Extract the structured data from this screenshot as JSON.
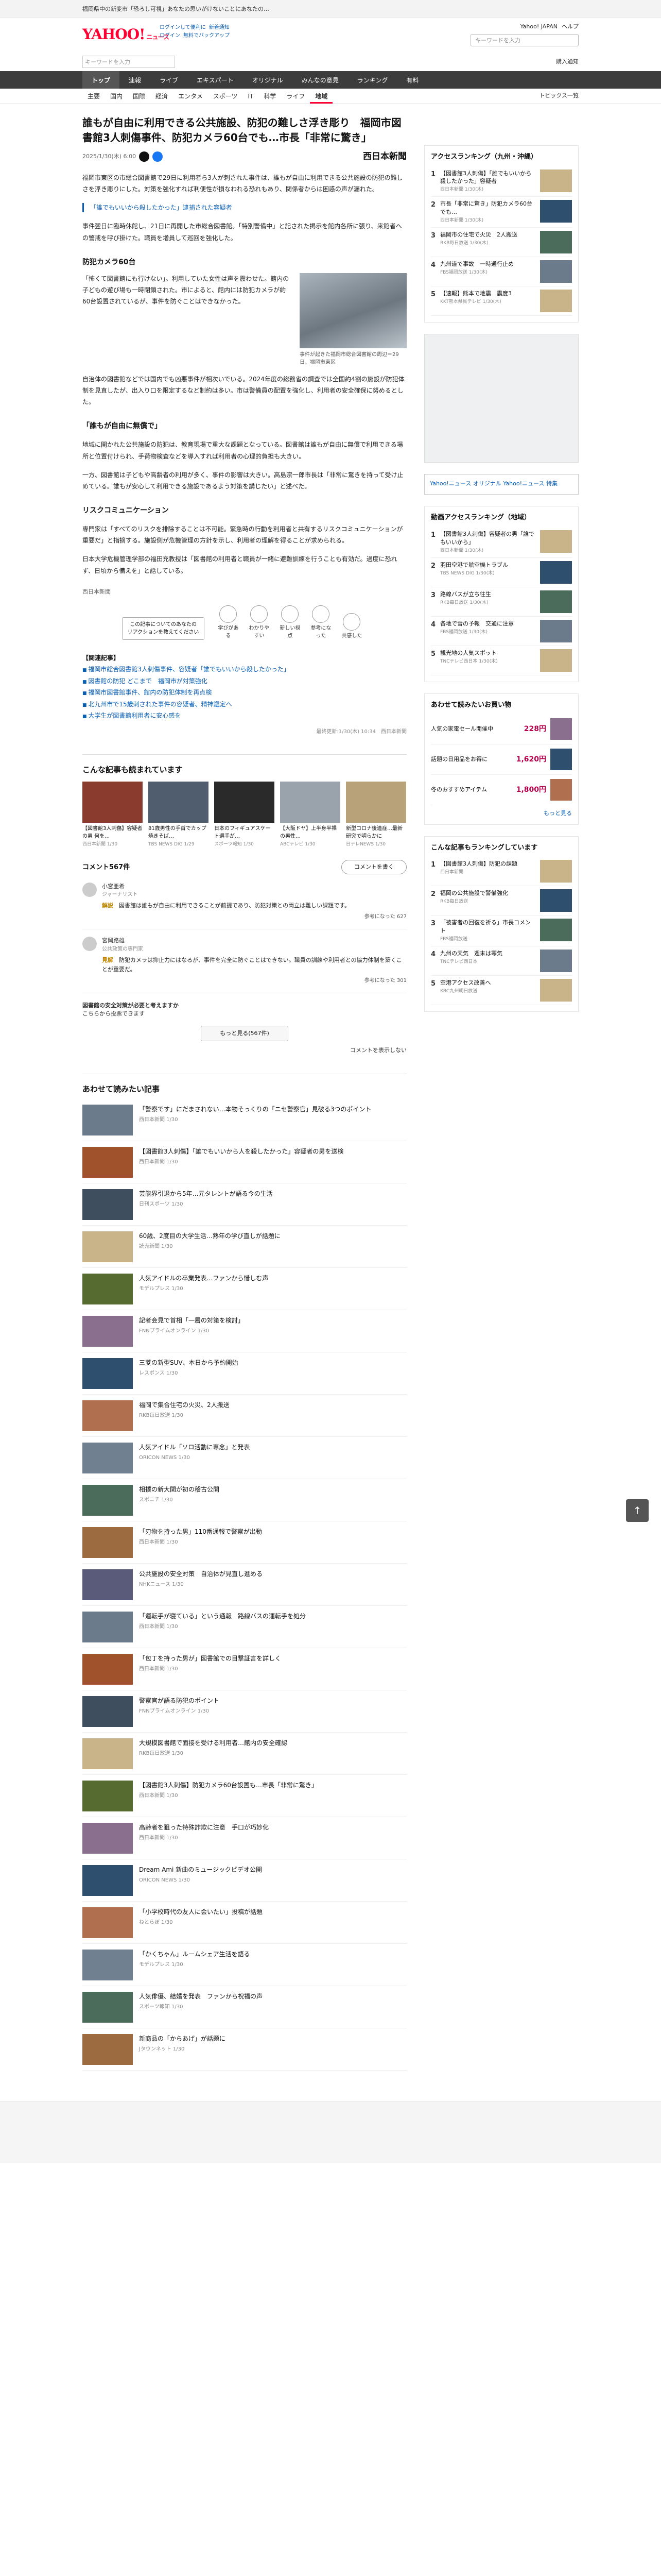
{
  "promo": {
    "text": "福岡県中の新変市「恐ろし可視」あなたの思いがけないことにあなたの…"
  },
  "masthead": {
    "logo": "YAHOO!",
    "logo_sub": "JAPAN",
    "service": "ニュース",
    "links": [
      "ログインして便利に",
      "新着通知",
      "ログイン",
      "無料でバックアップ"
    ],
    "right_links": [
      "Yahoo! JAPAN",
      "ヘルプ"
    ],
    "search_placeholder": "キーワードを入力"
  },
  "searchrow": {
    "placeholder": "キーワードを入力",
    "right": "購入通知"
  },
  "gnav": [
    "トップ",
    "速報",
    "ライブ",
    "エキスパート",
    "オリジナル",
    "みんなの意見",
    "ランキング",
    "有料"
  ],
  "gnav_active": 0,
  "subnav": [
    "主要",
    "国内",
    "国際",
    "経済",
    "エンタメ",
    "スポーツ",
    "IT",
    "科学",
    "ライフ",
    "地域"
  ],
  "subnav_active": 9,
  "subnav_right": "トピックス一覧",
  "article": {
    "title": "誰もが自由に利用できる公共施設、防犯の難しさ浮き彫り　福岡市図書館3人刺傷事件、防犯カメラ60台でも…市長「非常に驚き」",
    "date": "2025/1/30(木) 6:00",
    "publisher": "西日本新聞",
    "lead": "福岡市東区の市総合図書館で29日に利用者ら3人が刺された事件は、誰もが自由に利用できる公共施設の防犯の難しさを浮き彫りにした。対策を強化すれば利便性が損なわれる恐れもあり、関係者からは困惑の声が漏れた。",
    "related_link": "「誰でもいいから殺したかった」逮捕された容疑者",
    "p1": "事件翌日に臨時休館し、21日に再開した市総合図書館。「特別警備中」と記された掲示を館内各所に張り、来館者への警戒を呼び掛けた。職員を増員して巡回を強化した。",
    "h2a": "防犯カメラ60台",
    "fig_text": "「怖くて図書館にも行けない」。利用していた女性は声を震わせた。館内の子どもの遊び場も一時閉鎖された。市によると、館内には防犯カメラが約60台設置されているが、事件を防ぐことはできなかった。",
    "fig_caption": "事件が起きた福岡市総合図書館の周辺＝29日、福岡市東区",
    "p2": "自治体の図書館などでは国内でも凶悪事件が相次いでいる。2024年度の総務省の調査では全国約4割の施設が防犯体制を見直したが、出入り口を限定するなど制約は多い。市は警備員の配置を強化し、利用者の安全確保に努めるとした。",
    "h2b": "「誰もが自由に無償で」",
    "p3": "地域に開かれた公共施設の防犯は、教育現場で重大な課題となっている。図書館は誰もが自由に無償で利用できる場所と位置付けられ、手荷物検査などを導入すれば利用者の心理的負担も大きい。",
    "p4": "一方、図書館は子どもや高齢者の利用が多く、事件の影響は大きい。高島宗一郎市長は「非常に驚きを持って受け止めている。誰もが安心して利用できる施設であるよう対策を講じたい」と述べた。",
    "h2c": "リスクコミュニケーション",
    "p5": "専門家は「すべてのリスクを排除することは不可能。緊急時の行動を利用者と共有するリスクコミュニケーションが重要だ」と指摘する。施設側が危機管理の方針を示し、利用者の理解を得ることが求められる。",
    "p6": "日本大学危機管理学部の福田充教授は「図書館の利用者と職員が一緒に避難訓練を行うことも有効だ。過度に恐れず、日頃から備えを」と話している。",
    "source": "西日本新聞",
    "bubble": "この記事についてのあなたの\nリアクションを教えてください",
    "reactions": [
      "学びがある",
      "わかりやすい",
      "新しい視点",
      "参考になった",
      "共感した"
    ],
    "related_title": "【関連記事】",
    "related": [
      "福岡市総合図書館3人刺傷事件、容疑者「誰でもいいから殺したかった」",
      "図書館の防犯 どこまで　福岡市が対策強化",
      "福岡市図書館事件、館内の防犯体制を再点検",
      "北九州市で15歳刺された事件の容疑者、精神鑑定へ",
      "大学生が図書館利用者に安心感を"
    ],
    "copyright": "最終更新:1/30(木) 10:34　西日本新聞"
  },
  "sections": {
    "also_read": "こんな記事も読まれています",
    "thumbs": [
      {
        "title": "【図書館3人刺傷】容疑者の男 何を…",
        "meta": "西日本新聞 1/30"
      },
      {
        "title": "81歳男性の手首でカップ焼きそば…",
        "meta": "TBS NEWS DIG 1/29"
      },
      {
        "title": "日本のフィギュアスケート選手が…",
        "meta": "スポーツ報知 1/30"
      },
      {
        "title": "【大阪ドヤ】上半身半裸の男性…",
        "meta": "ABCテレビ 1/30"
      },
      {
        "title": "新型コロナ後遺症…最新研究で明らかに",
        "meta": "日テレNEWS 1/30"
      }
    ],
    "comments_count": "コメント567件",
    "post_btn": "コメントを書く",
    "comments": [
      {
        "name": "小宮亜希",
        "role": "ジャーナリスト",
        "tag": "解説",
        "text": "図書館は誰もが自由に利用できることが前提であり、防犯対策との両立は難しい課題です。",
        "more": "参考になった 627"
      },
      {
        "name": "宮岡路雄",
        "role": "公共政策の専門家",
        "tag": "見解",
        "text": "防犯カメラは抑止力にはなるが、事件を完全に防ぐことはできない。職員の訓練や利用者との協力体制を築くことが重要だ。",
        "more": "参考になった 301"
      }
    ],
    "survey_q": "図書館の安全対策が必要と考えますか",
    "survey_sub": "こちらから投票できます",
    "more_comments": "もっと見る(567件)",
    "hide_comments": "コメントを表示しない",
    "recommend": "あわせて読みたい記事",
    "recs": [
      {
        "title": "「警察です」にだまされない…本物そっくりの「ニセ警察官」見破る3つのポイント",
        "meta": "西日本新聞 1/30"
      },
      {
        "title": "【図書館3人刺傷】「誰でもいいから人を殺したかった」容疑者の男を送検",
        "meta": "西日本新聞 1/30"
      },
      {
        "title": "芸能界引退から5年…元タレントが語る今の生活",
        "meta": "日刊スポーツ 1/30"
      },
      {
        "title": "60歳、2度目の大学生活…熟年の学び直しが話題に",
        "meta": "読売新聞 1/30"
      },
      {
        "title": "人気アイドルの卒業発表…ファンから惜しむ声",
        "meta": "モデルプレス 1/30"
      },
      {
        "title": "記者会見で首相「一層の対策を検討」",
        "meta": "FNNプライムオンライン 1/30"
      },
      {
        "title": "三菱の新型SUV、本日から予約開始",
        "meta": "レスポンス 1/30"
      },
      {
        "title": "福岡で集合住宅の火災、2人搬送",
        "meta": "RKB毎日放送 1/30"
      },
      {
        "title": "人気アイドル「ソロ活動に専念」と発表",
        "meta": "ORICON NEWS 1/30"
      },
      {
        "title": "相撲の新大関が初の稽古公開",
        "meta": "スポニチ 1/30"
      },
      {
        "title": "「刃物を持った男」110番通報で警察が出動",
        "meta": "西日本新聞 1/30"
      },
      {
        "title": "公共施設の安全対策　自治体が見直し進める",
        "meta": "NHKニュース 1/30"
      },
      {
        "title": "「運転手が寝ている」という通報　路線バスの運転手を処分",
        "meta": "西日本新聞 1/30"
      },
      {
        "title": "「包丁を持った男が」図書館での目撃証言を詳しく",
        "meta": "西日本新聞 1/30"
      },
      {
        "title": "警察官が語る防犯のポイント",
        "meta": "FNNプライムオンライン 1/30"
      },
      {
        "title": "大規模図書館で面接を受ける利用者…館内の安全確認",
        "meta": "RKB毎日放送 1/30"
      },
      {
        "title": "【図書館3人刺傷】防犯カメラ60台設置も…市長「非常に驚き」",
        "meta": "西日本新聞 1/30"
      },
      {
        "title": "高齢者を狙った特殊詐欺に注意　手口が巧妙化",
        "meta": "西日本新聞 1/30"
      },
      {
        "title": "Dream Ami 新曲のミュージックビデオ公開",
        "meta": "ORICON NEWS 1/30"
      },
      {
        "title": "「小学校時代の友人に会いたい」投稿が話題",
        "meta": "ねとらぼ 1/30"
      },
      {
        "title": "「かくちゃん」ルームシェア生活を語る",
        "meta": "モデルプレス 1/30"
      },
      {
        "title": "人気俳優、結婚を発表　ファンから祝福の声",
        "meta": "スポーツ報知 1/30"
      },
      {
        "title": "新商品の「からあげ」が話題に",
        "meta": "Jタウンネット 1/30"
      }
    ]
  },
  "side": {
    "ranking_title": "アクセスランキング（九州・沖縄）",
    "ranking": [
      {
        "t": "【図書館3人刺傷】「誰でもいいから殺したかった」容疑者",
        "s": "西日本新聞 1/30(木)"
      },
      {
        "t": "市長「非常に驚き」防犯カメラ60台でも…",
        "s": "西日本新聞 1/30(木)"
      },
      {
        "t": "福岡市の住宅で火災　2人搬送",
        "s": "RKB毎日放送 1/30(木)"
      },
      {
        "t": "九州道で事故　一時通行止め",
        "s": "FBS福岡放送 1/30(木)"
      },
      {
        "t": "【速報】熊本で地震　震度3",
        "s": "KKT熊本県民テレビ 1/30(木)"
      }
    ],
    "sub_title": "Yahoo!ニュース オリジナル",
    "sub_sub": "Yahoo!ニュース 特集",
    "ranking2_title": "動画アクセスランキング（地域）",
    "ranking2": [
      {
        "t": "【図書館3人刺傷】容疑者の男「誰でもいいから」",
        "s": "西日本新聞 1/30(木)"
      },
      {
        "t": "羽田空港で航空機トラブル",
        "s": "TBS NEWS DIG 1/30(木)"
      },
      {
        "t": "路線バスが立ち往生",
        "s": "RKB毎日放送 1/30(木)"
      },
      {
        "t": "各地で雪の予報　交通に注意",
        "s": "FBS福岡放送 1/30(木)"
      },
      {
        "t": "観光地の人気スポット",
        "s": "TNCテレビ西日本 1/30(木)"
      }
    ],
    "paypay_title": "あわせて読みたいお買い物",
    "paypay": [
      {
        "t": "人気の家電セール開催中",
        "p": "228円"
      },
      {
        "t": "話題の日用品をお得に",
        "p": "1,620円"
      },
      {
        "t": "冬のおすすめアイテム",
        "p": "1,800円"
      }
    ],
    "ranking3_title": "こんな記事もランキングしています",
    "ranking3": [
      {
        "t": "【図書館3人刺傷】防犯の課題",
        "s": "西日本新聞"
      },
      {
        "t": "福岡の公共施設で警備強化",
        "s": "RKB毎日放送"
      },
      {
        "t": "「被害者の回復を祈る」市長コメント",
        "s": "FBS福岡放送"
      },
      {
        "t": "九州の天気　週末は寒気",
        "s": "TNCテレビ西日本"
      },
      {
        "t": "空港アクセス改善へ",
        "s": "KBC九州朝日放送"
      }
    ],
    "more": "もっと見る"
  },
  "colors": {
    "accent": "#ff0033",
    "link": "#0b5fb3",
    "nav": "#3c3c3c"
  }
}
